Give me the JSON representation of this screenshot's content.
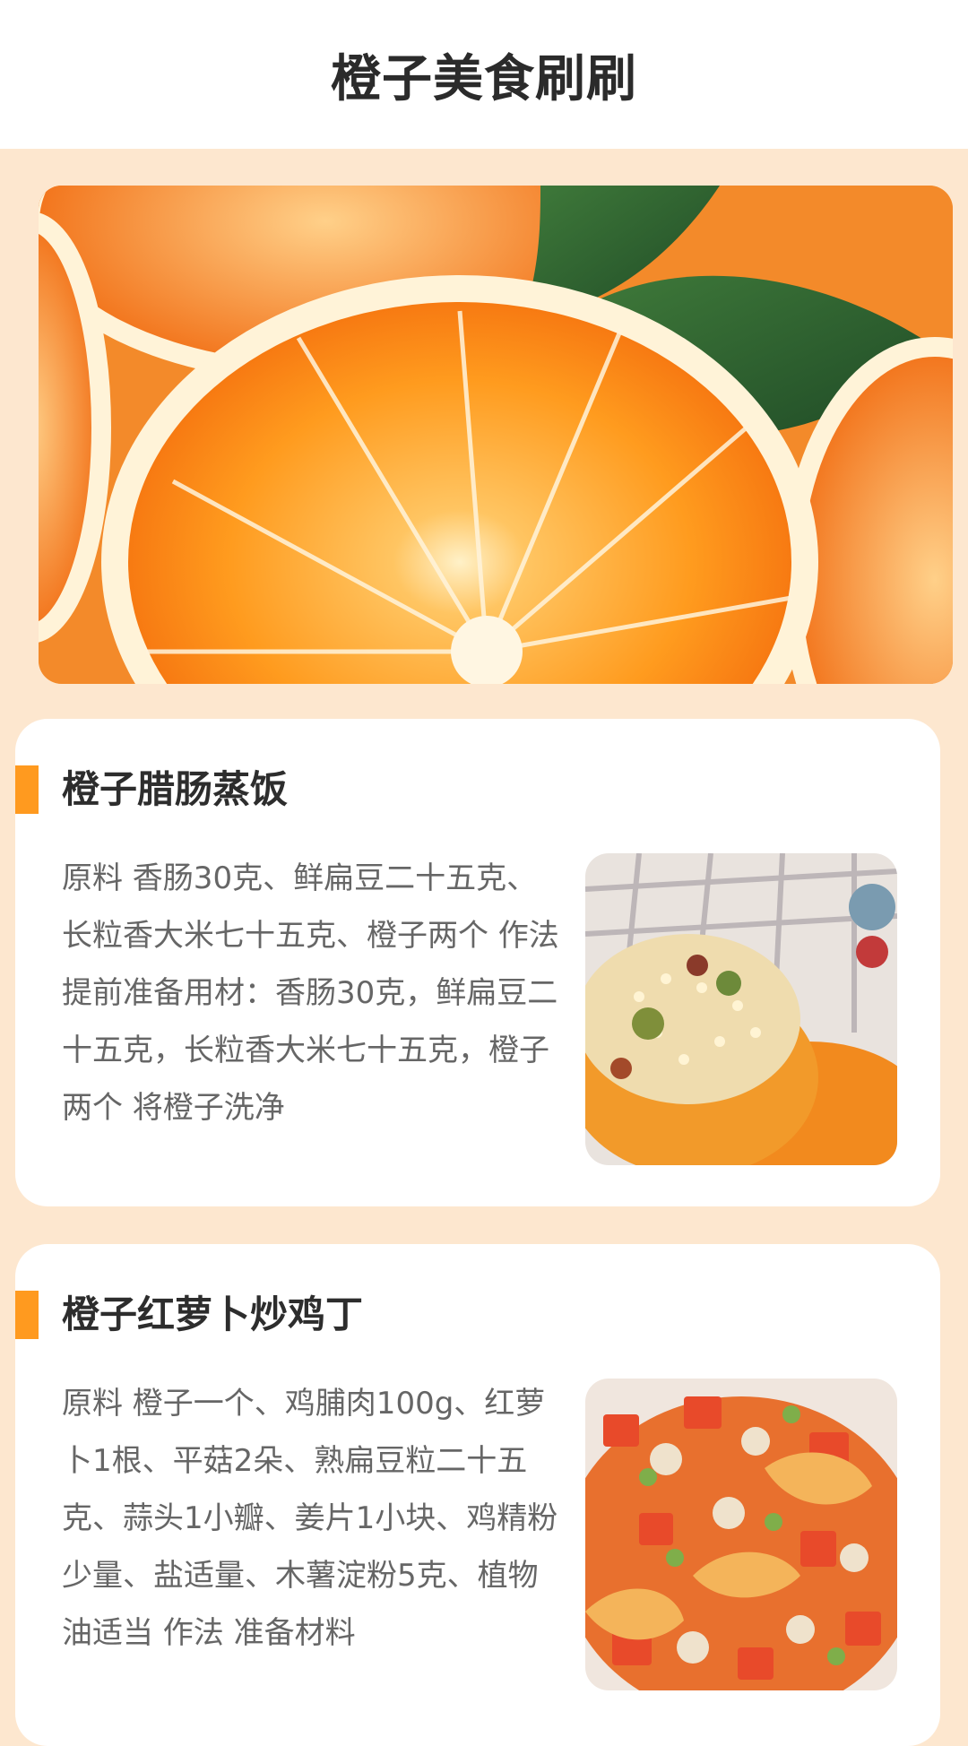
{
  "header": {
    "title": "橙子美食刷刷"
  },
  "banner": {
    "image": "orange-slices-photo"
  },
  "recipes": [
    {
      "title": "橙子腊肠蒸饭",
      "description": "原料 香肠30克、鲜扁豆二十五克、长粒香大米七十五克、橙子两个 作法 提前准备用材：香肠30克，鲜扁豆二十五克，长粒香大米七十五克，橙子两个 将橙子洗净",
      "image": "orange-sausage-rice-photo"
    },
    {
      "title": "橙子红萝卜炒鸡丁",
      "description": "原料 橙子一个、鸡脯肉100g、红萝卜1根、平菇2朵、熟扁豆粒二十五克、蒜头1小瓣、姜片1小块、鸡精粉少量、盐适量、木薯淀粉5克、植物油适当 作法 准备材料",
      "image": "orange-carrot-chicken-photo"
    }
  ],
  "colors": {
    "accent": "#ff9a1f",
    "page_background": "#fde7cf"
  }
}
